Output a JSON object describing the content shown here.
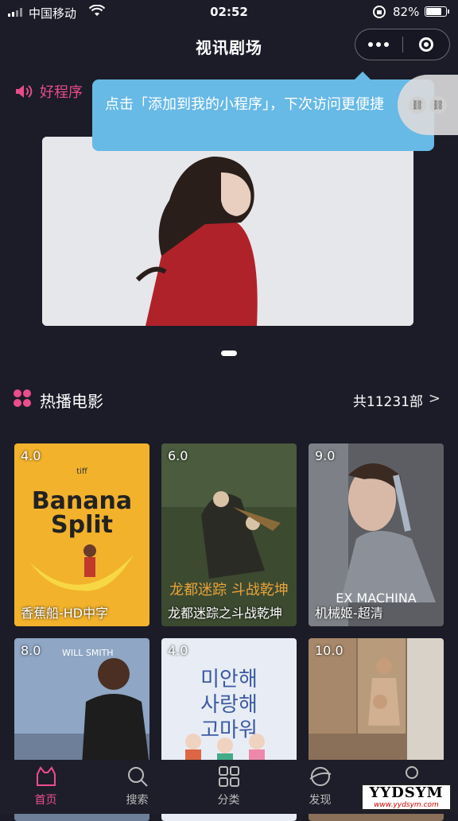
{
  "status_bar": {
    "carrier": "中国移动",
    "time": "02:52",
    "battery": "82%",
    "battery_level": 0.82
  },
  "nav": {
    "title": "视讯剧场"
  },
  "notice": {
    "text": "好程序"
  },
  "tooltip": {
    "text": "点击「添加到我的小程序」，下次访问更便捷"
  },
  "section": {
    "title": "热播电影",
    "count": "共11231部"
  },
  "movies": [
    {
      "rating": "4.0",
      "title": "香蕉船-HD中字",
      "color": "#f2b22c"
    },
    {
      "rating": "6.0",
      "title": "龙都迷踪之斗战乾坤",
      "color": "#3c4a30"
    },
    {
      "rating": "9.0",
      "title": "机械姬-超清",
      "color": "#6c6c70"
    },
    {
      "rating": "8.0",
      "title": "",
      "color": "#8fa6c4"
    },
    {
      "rating": "4.0",
      "title": "",
      "color": "#dfe6f2"
    },
    {
      "rating": "10.0",
      "title": "",
      "color": "#8a7058"
    }
  ],
  "poster_text": {
    "banana_top": "tiff",
    "banana_title_1": "Banana",
    "banana_title_2": "Split",
    "dragon_title": "龙都迷踪 斗战乾坤",
    "ex_machina": "EX MACHINA",
    "will_smith": "WILL SMITH",
    "korean_1": "미안해",
    "korean_2": "사랑해",
    "korean_3": "고마워"
  },
  "tabs": [
    {
      "label": "首页",
      "icon": "home-icon"
    },
    {
      "label": "搜索",
      "icon": "search-icon"
    },
    {
      "label": "分类",
      "icon": "category-icon"
    },
    {
      "label": "发现",
      "icon": "discover-icon"
    },
    {
      "label": "",
      "icon": "user-icon"
    }
  ],
  "watermark": {
    "big": "YYDSYM",
    "small": "www.yydsym.com"
  },
  "colors": {
    "accent": "#ec4d8c",
    "tooltip": "#67b9e6",
    "background": "#1b1c28"
  }
}
